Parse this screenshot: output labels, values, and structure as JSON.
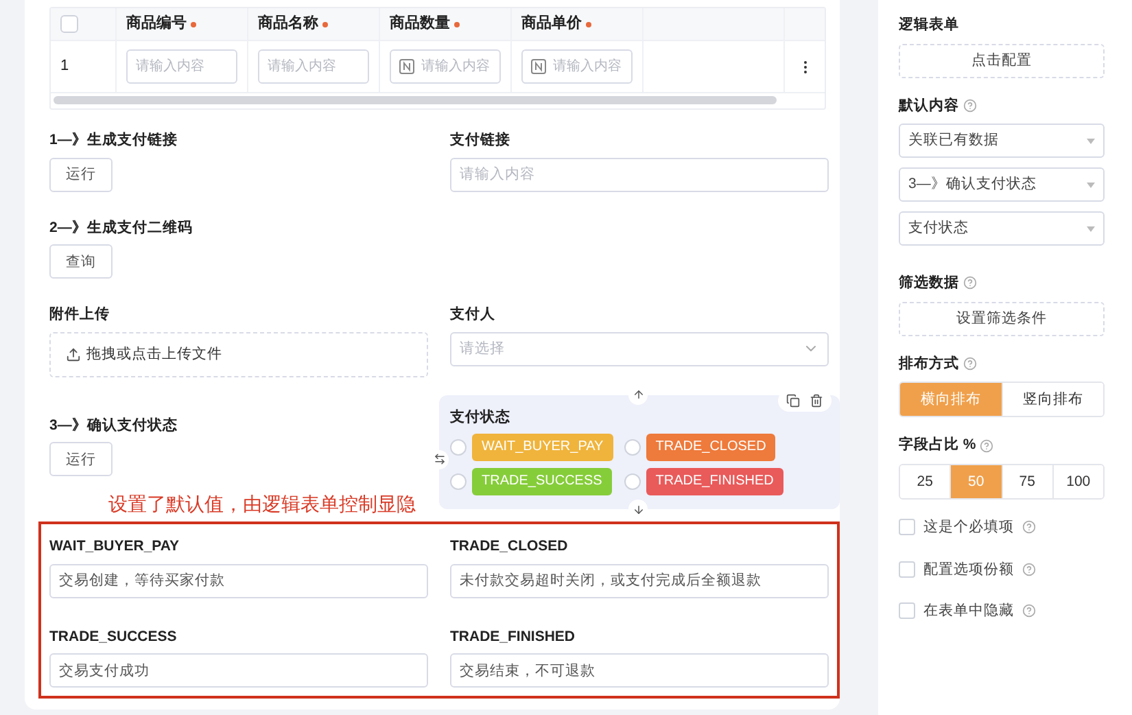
{
  "table": {
    "select_all_checked": false,
    "columns": [
      {
        "label": "商品编号",
        "required": true
      },
      {
        "label": "商品名称",
        "required": true
      },
      {
        "label": "商品数量",
        "required": true
      },
      {
        "label": "商品单价",
        "required": true
      }
    ],
    "rows": [
      {
        "index": "1",
        "cells": [
          {
            "placeholder": "请输入内容",
            "numeric": false
          },
          {
            "placeholder": "请输入内容",
            "numeric": false
          },
          {
            "placeholder": "请输入内容",
            "numeric": true
          },
          {
            "placeholder": "请输入内容",
            "numeric": true
          }
        ]
      }
    ]
  },
  "form_rows": [
    {
      "left": {
        "kind": "action",
        "label": "1—》生成支付链接",
        "button": "运行"
      },
      "right": {
        "kind": "input",
        "label": "支付链接",
        "placeholder": "请输入内容"
      }
    },
    {
      "left": {
        "kind": "action",
        "label": "2—》生成支付二维码",
        "button": "查询"
      }
    },
    {
      "left": {
        "kind": "upload",
        "label": "附件上传",
        "text": "拖拽或点击上传文件"
      },
      "right": {
        "kind": "select",
        "label": "支付人",
        "placeholder": "请选择"
      }
    },
    {
      "left": {
        "kind": "action",
        "label": "3—》确认支付状态",
        "button": "运行"
      },
      "right": {
        "kind": "radio",
        "label": "支付状态",
        "selected": true,
        "options": [
          {
            "label": "WAIT_BUYER_PAY",
            "color": "#f0b43c",
            "checked": false
          },
          {
            "label": "TRADE_CLOSED",
            "color": "#ee7a3b",
            "checked": false
          },
          {
            "label": "TRADE_SUCCESS",
            "color": "#86cd3a",
            "checked": false
          },
          {
            "label": "TRADE_FINISHED",
            "color": "#e95a5a",
            "checked": false
          }
        ]
      }
    }
  ],
  "annotation": "设置了默认值，由逻辑表单控制显隐",
  "hidden_fields": [
    {
      "label": "WAIT_BUYER_PAY",
      "value": "交易创建，等待买家付款"
    },
    {
      "label": "TRADE_CLOSED",
      "value": "未付款交易超时关闭，或支付完成后全额退款"
    },
    {
      "label": "TRADE_SUCCESS",
      "value": "交易支付成功"
    },
    {
      "label": "TRADE_FINISHED",
      "value": "交易结束，不可退款"
    }
  ],
  "settings": [
    {
      "kind": "dashed",
      "title": "逻辑表单",
      "button": "点击配置"
    },
    {
      "kind": "selects",
      "title": "默认内容",
      "help": true,
      "values": [
        "关联已有数据",
        "3—》确认支付状态",
        "支付状态"
      ]
    },
    {
      "kind": "dashed",
      "title": "筛选数据",
      "help": true,
      "button": "设置筛选条件"
    },
    {
      "kind": "segments",
      "title": "排布方式",
      "help": true,
      "options": [
        {
          "label": "横向排布",
          "selected": true
        },
        {
          "label": "竖向排布",
          "selected": false
        }
      ]
    },
    {
      "kind": "segments",
      "title": "字段占比 %",
      "help": true,
      "options": [
        {
          "label": "25",
          "selected": false
        },
        {
          "label": "50",
          "selected": true
        },
        {
          "label": "75",
          "selected": false
        },
        {
          "label": "100",
          "selected": false
        }
      ]
    },
    {
      "kind": "checkbox",
      "title": "这是个必填项",
      "help": true,
      "checked": false
    },
    {
      "kind": "checkbox",
      "title": "配置选项份额",
      "help": true,
      "checked": false
    },
    {
      "kind": "checkbox",
      "title": "在表单中隐藏",
      "help": true,
      "checked": false
    }
  ]
}
